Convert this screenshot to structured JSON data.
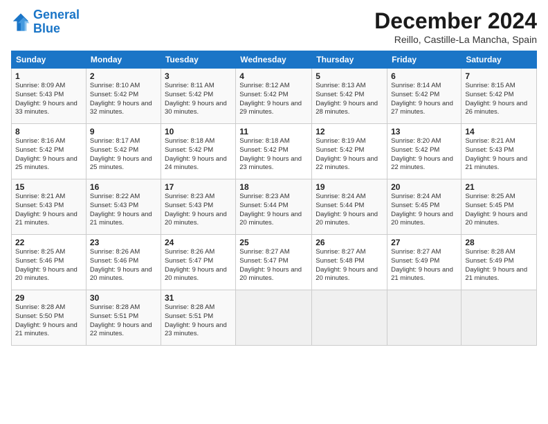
{
  "logo": {
    "line1": "General",
    "line2": "Blue"
  },
  "title": "December 2024",
  "subtitle": "Reillo, Castille-La Mancha, Spain",
  "weekdays": [
    "Sunday",
    "Monday",
    "Tuesday",
    "Wednesday",
    "Thursday",
    "Friday",
    "Saturday"
  ],
  "weeks": [
    [
      {
        "day": "1",
        "sunrise": "Sunrise: 8:09 AM",
        "sunset": "Sunset: 5:43 PM",
        "daylight": "Daylight: 9 hours and 33 minutes."
      },
      {
        "day": "2",
        "sunrise": "Sunrise: 8:10 AM",
        "sunset": "Sunset: 5:42 PM",
        "daylight": "Daylight: 9 hours and 32 minutes."
      },
      {
        "day": "3",
        "sunrise": "Sunrise: 8:11 AM",
        "sunset": "Sunset: 5:42 PM",
        "daylight": "Daylight: 9 hours and 30 minutes."
      },
      {
        "day": "4",
        "sunrise": "Sunrise: 8:12 AM",
        "sunset": "Sunset: 5:42 PM",
        "daylight": "Daylight: 9 hours and 29 minutes."
      },
      {
        "day": "5",
        "sunrise": "Sunrise: 8:13 AM",
        "sunset": "Sunset: 5:42 PM",
        "daylight": "Daylight: 9 hours and 28 minutes."
      },
      {
        "day": "6",
        "sunrise": "Sunrise: 8:14 AM",
        "sunset": "Sunset: 5:42 PM",
        "daylight": "Daylight: 9 hours and 27 minutes."
      },
      {
        "day": "7",
        "sunrise": "Sunrise: 8:15 AM",
        "sunset": "Sunset: 5:42 PM",
        "daylight": "Daylight: 9 hours and 26 minutes."
      }
    ],
    [
      {
        "day": "8",
        "sunrise": "Sunrise: 8:16 AM",
        "sunset": "Sunset: 5:42 PM",
        "daylight": "Daylight: 9 hours and 25 minutes."
      },
      {
        "day": "9",
        "sunrise": "Sunrise: 8:17 AM",
        "sunset": "Sunset: 5:42 PM",
        "daylight": "Daylight: 9 hours and 25 minutes."
      },
      {
        "day": "10",
        "sunrise": "Sunrise: 8:18 AM",
        "sunset": "Sunset: 5:42 PM",
        "daylight": "Daylight: 9 hours and 24 minutes."
      },
      {
        "day": "11",
        "sunrise": "Sunrise: 8:18 AM",
        "sunset": "Sunset: 5:42 PM",
        "daylight": "Daylight: 9 hours and 23 minutes."
      },
      {
        "day": "12",
        "sunrise": "Sunrise: 8:19 AM",
        "sunset": "Sunset: 5:42 PM",
        "daylight": "Daylight: 9 hours and 22 minutes."
      },
      {
        "day": "13",
        "sunrise": "Sunrise: 8:20 AM",
        "sunset": "Sunset: 5:42 PM",
        "daylight": "Daylight: 9 hours and 22 minutes."
      },
      {
        "day": "14",
        "sunrise": "Sunrise: 8:21 AM",
        "sunset": "Sunset: 5:43 PM",
        "daylight": "Daylight: 9 hours and 21 minutes."
      }
    ],
    [
      {
        "day": "15",
        "sunrise": "Sunrise: 8:21 AM",
        "sunset": "Sunset: 5:43 PM",
        "daylight": "Daylight: 9 hours and 21 minutes."
      },
      {
        "day": "16",
        "sunrise": "Sunrise: 8:22 AM",
        "sunset": "Sunset: 5:43 PM",
        "daylight": "Daylight: 9 hours and 21 minutes."
      },
      {
        "day": "17",
        "sunrise": "Sunrise: 8:23 AM",
        "sunset": "Sunset: 5:43 PM",
        "daylight": "Daylight: 9 hours and 20 minutes."
      },
      {
        "day": "18",
        "sunrise": "Sunrise: 8:23 AM",
        "sunset": "Sunset: 5:44 PM",
        "daylight": "Daylight: 9 hours and 20 minutes."
      },
      {
        "day": "19",
        "sunrise": "Sunrise: 8:24 AM",
        "sunset": "Sunset: 5:44 PM",
        "daylight": "Daylight: 9 hours and 20 minutes."
      },
      {
        "day": "20",
        "sunrise": "Sunrise: 8:24 AM",
        "sunset": "Sunset: 5:45 PM",
        "daylight": "Daylight: 9 hours and 20 minutes."
      },
      {
        "day": "21",
        "sunrise": "Sunrise: 8:25 AM",
        "sunset": "Sunset: 5:45 PM",
        "daylight": "Daylight: 9 hours and 20 minutes."
      }
    ],
    [
      {
        "day": "22",
        "sunrise": "Sunrise: 8:25 AM",
        "sunset": "Sunset: 5:46 PM",
        "daylight": "Daylight: 9 hours and 20 minutes."
      },
      {
        "day": "23",
        "sunrise": "Sunrise: 8:26 AM",
        "sunset": "Sunset: 5:46 PM",
        "daylight": "Daylight: 9 hours and 20 minutes."
      },
      {
        "day": "24",
        "sunrise": "Sunrise: 8:26 AM",
        "sunset": "Sunset: 5:47 PM",
        "daylight": "Daylight: 9 hours and 20 minutes."
      },
      {
        "day": "25",
        "sunrise": "Sunrise: 8:27 AM",
        "sunset": "Sunset: 5:47 PM",
        "daylight": "Daylight: 9 hours and 20 minutes."
      },
      {
        "day": "26",
        "sunrise": "Sunrise: 8:27 AM",
        "sunset": "Sunset: 5:48 PM",
        "daylight": "Daylight: 9 hours and 20 minutes."
      },
      {
        "day": "27",
        "sunrise": "Sunrise: 8:27 AM",
        "sunset": "Sunset: 5:49 PM",
        "daylight": "Daylight: 9 hours and 21 minutes."
      },
      {
        "day": "28",
        "sunrise": "Sunrise: 8:28 AM",
        "sunset": "Sunset: 5:49 PM",
        "daylight": "Daylight: 9 hours and 21 minutes."
      }
    ],
    [
      {
        "day": "29",
        "sunrise": "Sunrise: 8:28 AM",
        "sunset": "Sunset: 5:50 PM",
        "daylight": "Daylight: 9 hours and 21 minutes."
      },
      {
        "day": "30",
        "sunrise": "Sunrise: 8:28 AM",
        "sunset": "Sunset: 5:51 PM",
        "daylight": "Daylight: 9 hours and 22 minutes."
      },
      {
        "day": "31",
        "sunrise": "Sunrise: 8:28 AM",
        "sunset": "Sunset: 5:51 PM",
        "daylight": "Daylight: 9 hours and 23 minutes."
      },
      null,
      null,
      null,
      null
    ]
  ]
}
